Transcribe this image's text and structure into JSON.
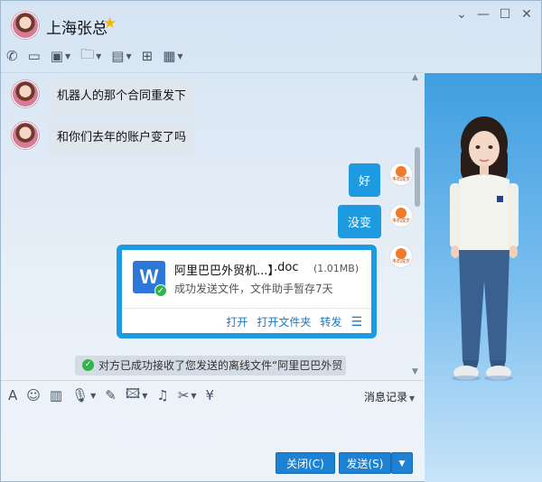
{
  "window": {
    "contact_name": "上海张总",
    "controls": {
      "menu": "⌄",
      "minimize": "—",
      "maximize": "☐",
      "close": "✕"
    }
  },
  "toolbar": {
    "items": [
      {
        "name": "phone-icon",
        "glyph": "✆",
        "caret": false
      },
      {
        "name": "video-icon",
        "glyph": "▭",
        "caret": false
      },
      {
        "name": "screen-share-icon",
        "glyph": "▣",
        "caret": true
      },
      {
        "name": "file-transfer-icon",
        "glyph": "🗀",
        "caret": true
      },
      {
        "name": "remote-desktop-icon",
        "glyph": "▤",
        "caret": true
      },
      {
        "name": "add-member-icon",
        "glyph": "⊞",
        "caret": false
      },
      {
        "name": "apps-icon",
        "glyph": "▦",
        "caret": true
      }
    ]
  },
  "messages": {
    "incoming": [
      {
        "text": "机器人的那个合同重发下"
      },
      {
        "text": "和你们去年的账户变了吗"
      }
    ],
    "outgoing": [
      {
        "text": "好"
      },
      {
        "text": "没变"
      }
    ],
    "avatar_text": "韦石成岁"
  },
  "file_card": {
    "icon_letter": "W",
    "name": "阿里巴巴外贸机...】",
    "ext": ".doc",
    "size": "(1.01MB)",
    "status": "成功发送文件，文件助手暂存7天",
    "actions": {
      "open": "打开",
      "open_folder": "打开文件夹",
      "forward": "转发"
    }
  },
  "notice": {
    "text": "对方已成功接收了您发送的离线文件“阿里巴巴外贸"
  },
  "input_toolbar": {
    "items": [
      {
        "name": "font-icon",
        "glyph": "A",
        "caret": false
      },
      {
        "name": "emoji-icon",
        "glyph": "☺",
        "caret": false
      },
      {
        "name": "gif-icon",
        "glyph": "▥",
        "caret": false
      },
      {
        "name": "voice-icon",
        "glyph": "🎙",
        "caret": true
      },
      {
        "name": "draw-icon",
        "glyph": "✎",
        "caret": false
      },
      {
        "name": "image-icon",
        "glyph": "🖾",
        "caret": true
      },
      {
        "name": "music-icon",
        "glyph": "♫",
        "caret": false
      },
      {
        "name": "screenshot-icon",
        "glyph": "✂",
        "caret": true
      },
      {
        "name": "red-packet-icon",
        "glyph": "¥",
        "caret": false
      }
    ],
    "history_label": "消息记录"
  },
  "buttons": {
    "close": "关闭(C)",
    "send": "发送(S)"
  },
  "colors": {
    "accent": "#1e9be0",
    "button": "#1e82d4",
    "success": "#33b24a"
  }
}
